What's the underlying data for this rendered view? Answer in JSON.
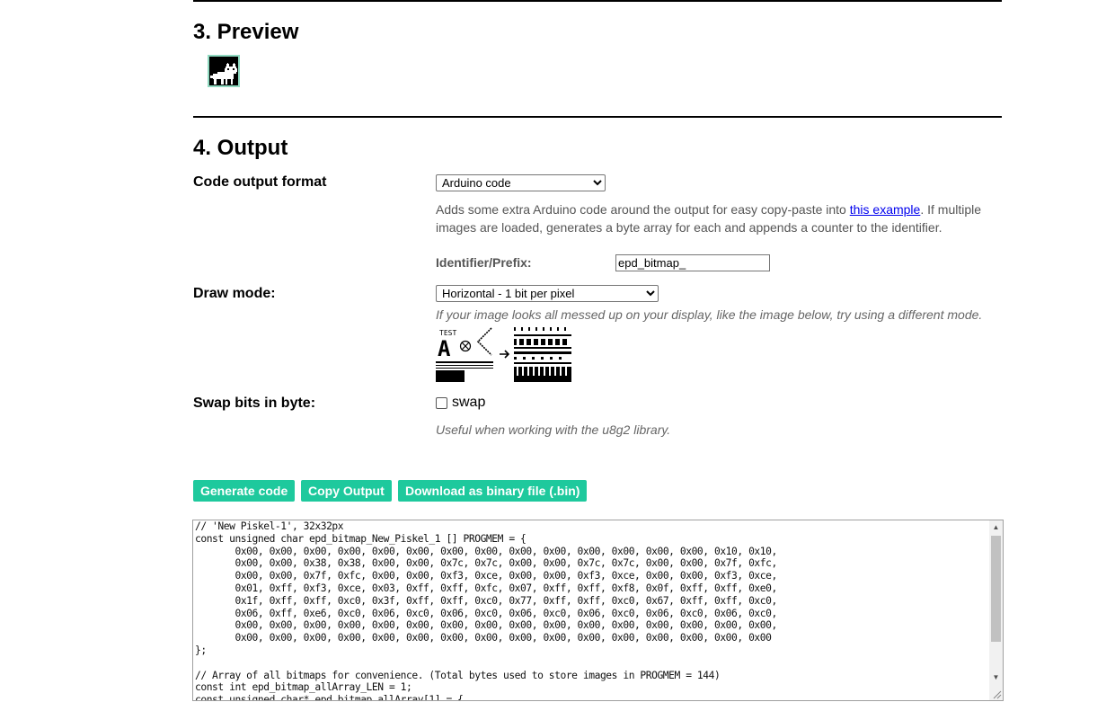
{
  "preview": {
    "heading": "3. Preview",
    "thumbnail_icon": "pixel-cat-icon"
  },
  "output": {
    "heading": "4. Output",
    "format": {
      "label": "Code output format",
      "selected": "Arduino code",
      "description_before": "Adds some extra Arduino code around the output for easy copy-paste into ",
      "link_text": "this example",
      "description_after": ". If multiple images are loaded, generates a byte array for each and appends a counter to the identifier.",
      "identifier_label": "Identifier/Prefix:",
      "identifier_value": "epd_bitmap_"
    },
    "draw_mode": {
      "label": "Draw mode:",
      "selected": "Horizontal - 1 bit per pixel",
      "hint": "If your image looks all messed up on your display, like the image below, try using a different mode.",
      "example_caption": "TEST",
      "example_glyph": "A"
    },
    "swap": {
      "label": "Swap bits in byte:",
      "checkbox_label": "swap",
      "checked": false,
      "hint": "Useful when working with the u8g2 library."
    },
    "buttons": {
      "generate": "Generate code",
      "copy": "Copy Output",
      "download": "Download as binary file (.bin)"
    },
    "code": "// 'New Piskel-1', 32x32px\nconst unsigned char epd_bitmap_New_Piskel_1 [] PROGMEM = {\n\t0x00, 0x00, 0x00, 0x00, 0x00, 0x00, 0x00, 0x00, 0x00, 0x00, 0x00, 0x00, 0x00, 0x00, 0x10, 0x10,\n\t0x00, 0x00, 0x38, 0x38, 0x00, 0x00, 0x7c, 0x7c, 0x00, 0x00, 0x7c, 0x7c, 0x00, 0x00, 0x7f, 0xfc,\n\t0x00, 0x00, 0x7f, 0xfc, 0x00, 0x00, 0xf3, 0xce, 0x00, 0x00, 0xf3, 0xce, 0x00, 0x00, 0xf3, 0xce,\n\t0x01, 0xff, 0xf3, 0xce, 0x03, 0xff, 0xff, 0xfc, 0x07, 0xff, 0xff, 0xf8, 0x0f, 0xff, 0xff, 0xe0,\n\t0x1f, 0xff, 0xff, 0xc0, 0x3f, 0xff, 0xff, 0xc0, 0x77, 0xff, 0xff, 0xc0, 0x67, 0xff, 0xff, 0xc0,\n\t0x06, 0xff, 0xe6, 0xc0, 0x06, 0xc0, 0x06, 0xc0, 0x06, 0xc0, 0x06, 0xc0, 0x06, 0xc0, 0x06, 0xc0,\n\t0x00, 0x00, 0x00, 0x00, 0x00, 0x00, 0x00, 0x00, 0x00, 0x00, 0x00, 0x00, 0x00, 0x00, 0x00, 0x00,\n\t0x00, 0x00, 0x00, 0x00, 0x00, 0x00, 0x00, 0x00, 0x00, 0x00, 0x00, 0x00, 0x00, 0x00, 0x00, 0x00\n};\n\n// Array of all bitmaps for convenience. (Total bytes used to store images in PROGMEM = 144)\nconst int epd_bitmap_allArray_LEN = 1;\nconst unsigned char* epd_bitmap_allArray[1] = {"
  },
  "colors": {
    "button_bg": "#1ec99d",
    "preview_border": "#8fd9c0",
    "link": "#0000ee"
  }
}
